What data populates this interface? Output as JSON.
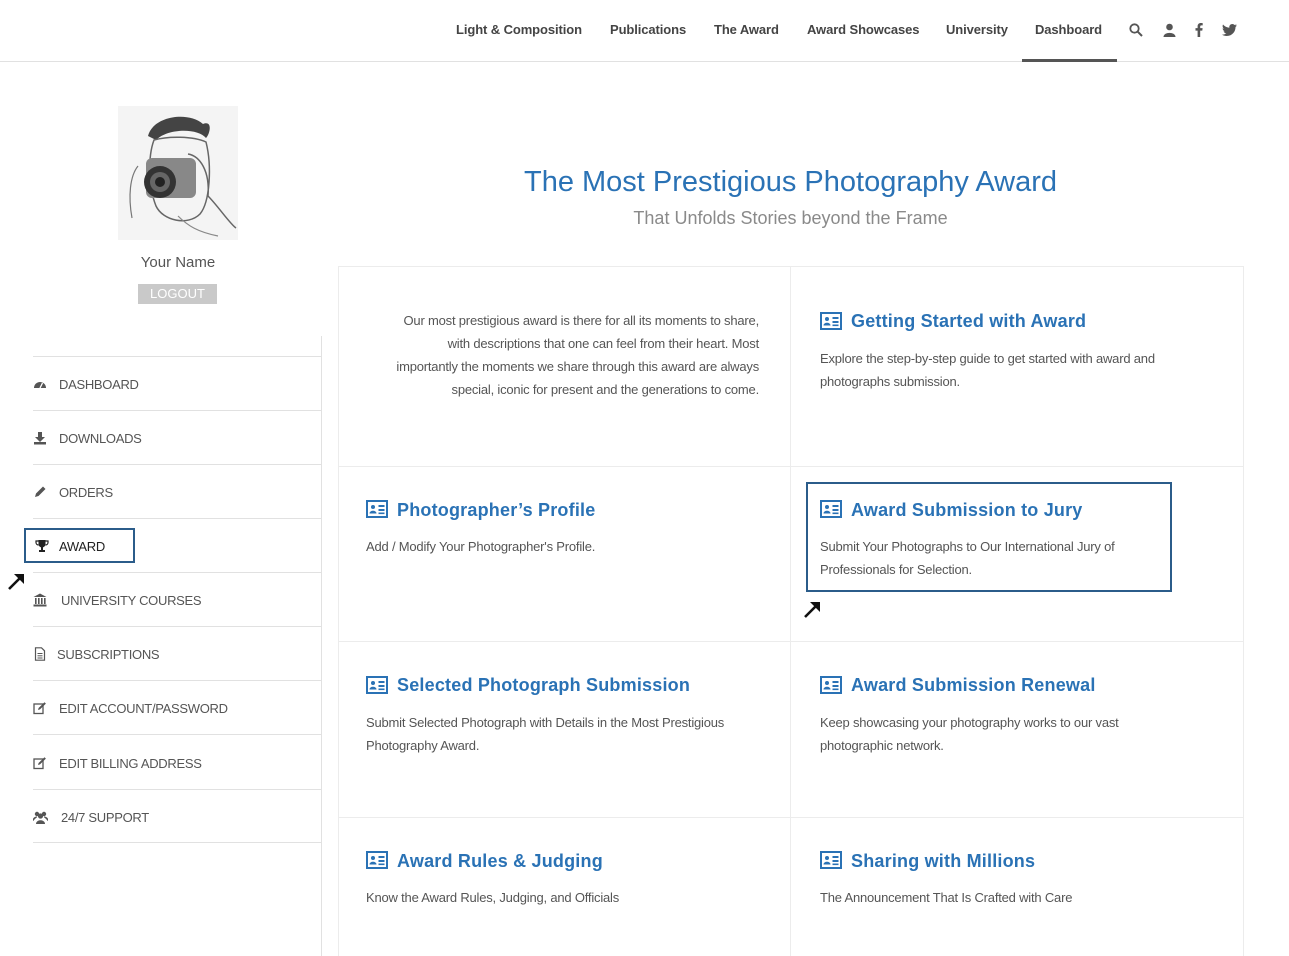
{
  "nav": {
    "items": [
      "Light & Composition",
      "Publications",
      "The Award",
      "Award Showcases",
      "University",
      "Dashboard"
    ],
    "active": "Dashboard",
    "icons": [
      "search-icon",
      "user-icon",
      "facebook-icon",
      "twitter-icon"
    ]
  },
  "sidebar": {
    "username": "Your Name",
    "logout_label": "LOGOUT",
    "items": [
      {
        "label": "DASHBOARD",
        "icon": "dashboard-icon"
      },
      {
        "label": "DOWNLOADS",
        "icon": "download-icon"
      },
      {
        "label": "ORDERS",
        "icon": "pencil-icon"
      },
      {
        "label": "AWARD",
        "icon": "trophy-icon"
      },
      {
        "label": "UNIVERSITY COURSES",
        "icon": "institution-icon"
      },
      {
        "label": "SUBSCRIPTIONS",
        "icon": "document-icon"
      },
      {
        "label": "EDIT ACCOUNT/PASSWORD",
        "icon": "edit-icon"
      },
      {
        "label": "EDIT BILLING ADDRESS",
        "icon": "edit-icon"
      },
      {
        "label": "24/7 SUPPORT",
        "icon": "users-icon"
      }
    ]
  },
  "main": {
    "title": "The Most Prestigious Photography Award",
    "subtitle": "That Unfolds Stories beyond the Frame",
    "intro": "Our most prestigious award is there for all its moments to share, with descriptions that one can feel from their heart. Most importantly the moments we share through this award are always special, iconic for present and the generations to come.",
    "cards": [
      {
        "title": "Getting Started with Award",
        "desc": "Explore the step-by-step guide to get started with award and photographs submission."
      },
      {
        "title": "Photographer’s Profile",
        "desc": "Add / Modify Your Photographer's Profile."
      },
      {
        "title": "Award Submission to Jury",
        "desc": "Submit Your Photographs to Our International Jury of Professionals for Selection."
      },
      {
        "title": "Selected Photograph Submission",
        "desc": "Submit Selected Photograph with Details in the Most Prestigious Photography Award."
      },
      {
        "title": "Award Submission Renewal",
        "desc": "Keep showcasing your photography works to our vast photographic network."
      },
      {
        "title": "Award Rules & Judging",
        "desc": "Know the Award Rules, Judging, and Officials"
      },
      {
        "title": "Sharing with Millions",
        "desc": "The Announcement That Is Crafted with Care"
      }
    ]
  },
  "colors": {
    "accent": "#2a72b5",
    "highlight": "#2b5c8a",
    "logout_bg": "#c9c9c9"
  }
}
